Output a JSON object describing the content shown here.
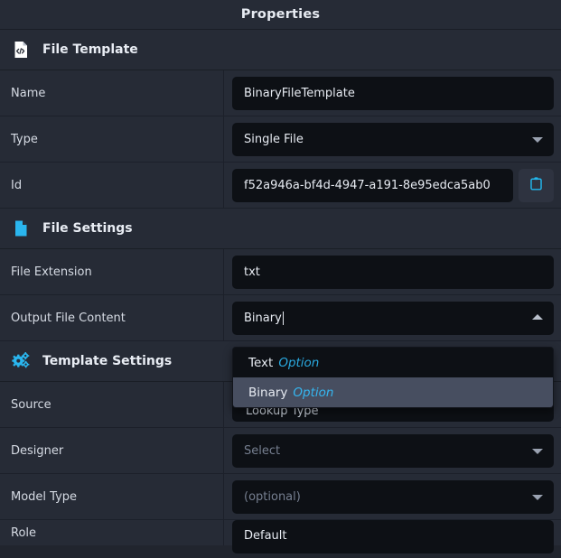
{
  "window": {
    "title": "Properties"
  },
  "sections": [
    {
      "id": "file-template",
      "title": "File Template",
      "icon": "file-code-icon",
      "icon_color": "#ffffff",
      "rows": [
        {
          "label": "Name",
          "control": "text",
          "value": "BinaryFileTemplate"
        },
        {
          "label": "Type",
          "control": "select",
          "value": "Single File"
        },
        {
          "label": "Id",
          "control": "text-copy",
          "value": "f52a946a-bf4d-4947-a191-8e95edca5ab0"
        }
      ]
    },
    {
      "id": "file-settings",
      "title": "File Settings",
      "icon": "file-icon",
      "icon_color": "#2ab6ef",
      "rows": [
        {
          "label": "File Extension",
          "control": "text",
          "value": "txt"
        },
        {
          "label": "Output File Content",
          "control": "select-open",
          "value": "Binary"
        }
      ]
    },
    {
      "id": "template-settings",
      "title": "Template Settings",
      "icon": "gears-icon",
      "icon_color": "#2ab6ef",
      "rows": [
        {
          "label": "Source",
          "control": "hidden-behind-dropdown",
          "value": ""
        },
        {
          "label": "Designer",
          "control": "select",
          "value": "",
          "placeholder": "Select"
        },
        {
          "label": "Model Type",
          "control": "select",
          "value": "",
          "placeholder": "(optional)"
        },
        {
          "label": "Role",
          "control": "text",
          "value": "Default"
        }
      ]
    }
  ],
  "dropdown": {
    "open": true,
    "options": [
      {
        "label": "Text",
        "kind": "Option",
        "selected": false
      },
      {
        "label": "Binary",
        "kind": "Option",
        "selected": true
      }
    ]
  },
  "obscured": {
    "lookup_type_label": "Lookup Type"
  },
  "icons": {
    "copy": "clipboard-icon",
    "chevron_down": "chevron-down-icon",
    "chevron_up": "chevron-up-icon"
  },
  "colors": {
    "panel": "#262b36",
    "input": "#0d1015",
    "accent": "#2ab6ef",
    "highlight": "#474e60",
    "text": "#e7ebf2",
    "placeholder": "#767f90"
  }
}
